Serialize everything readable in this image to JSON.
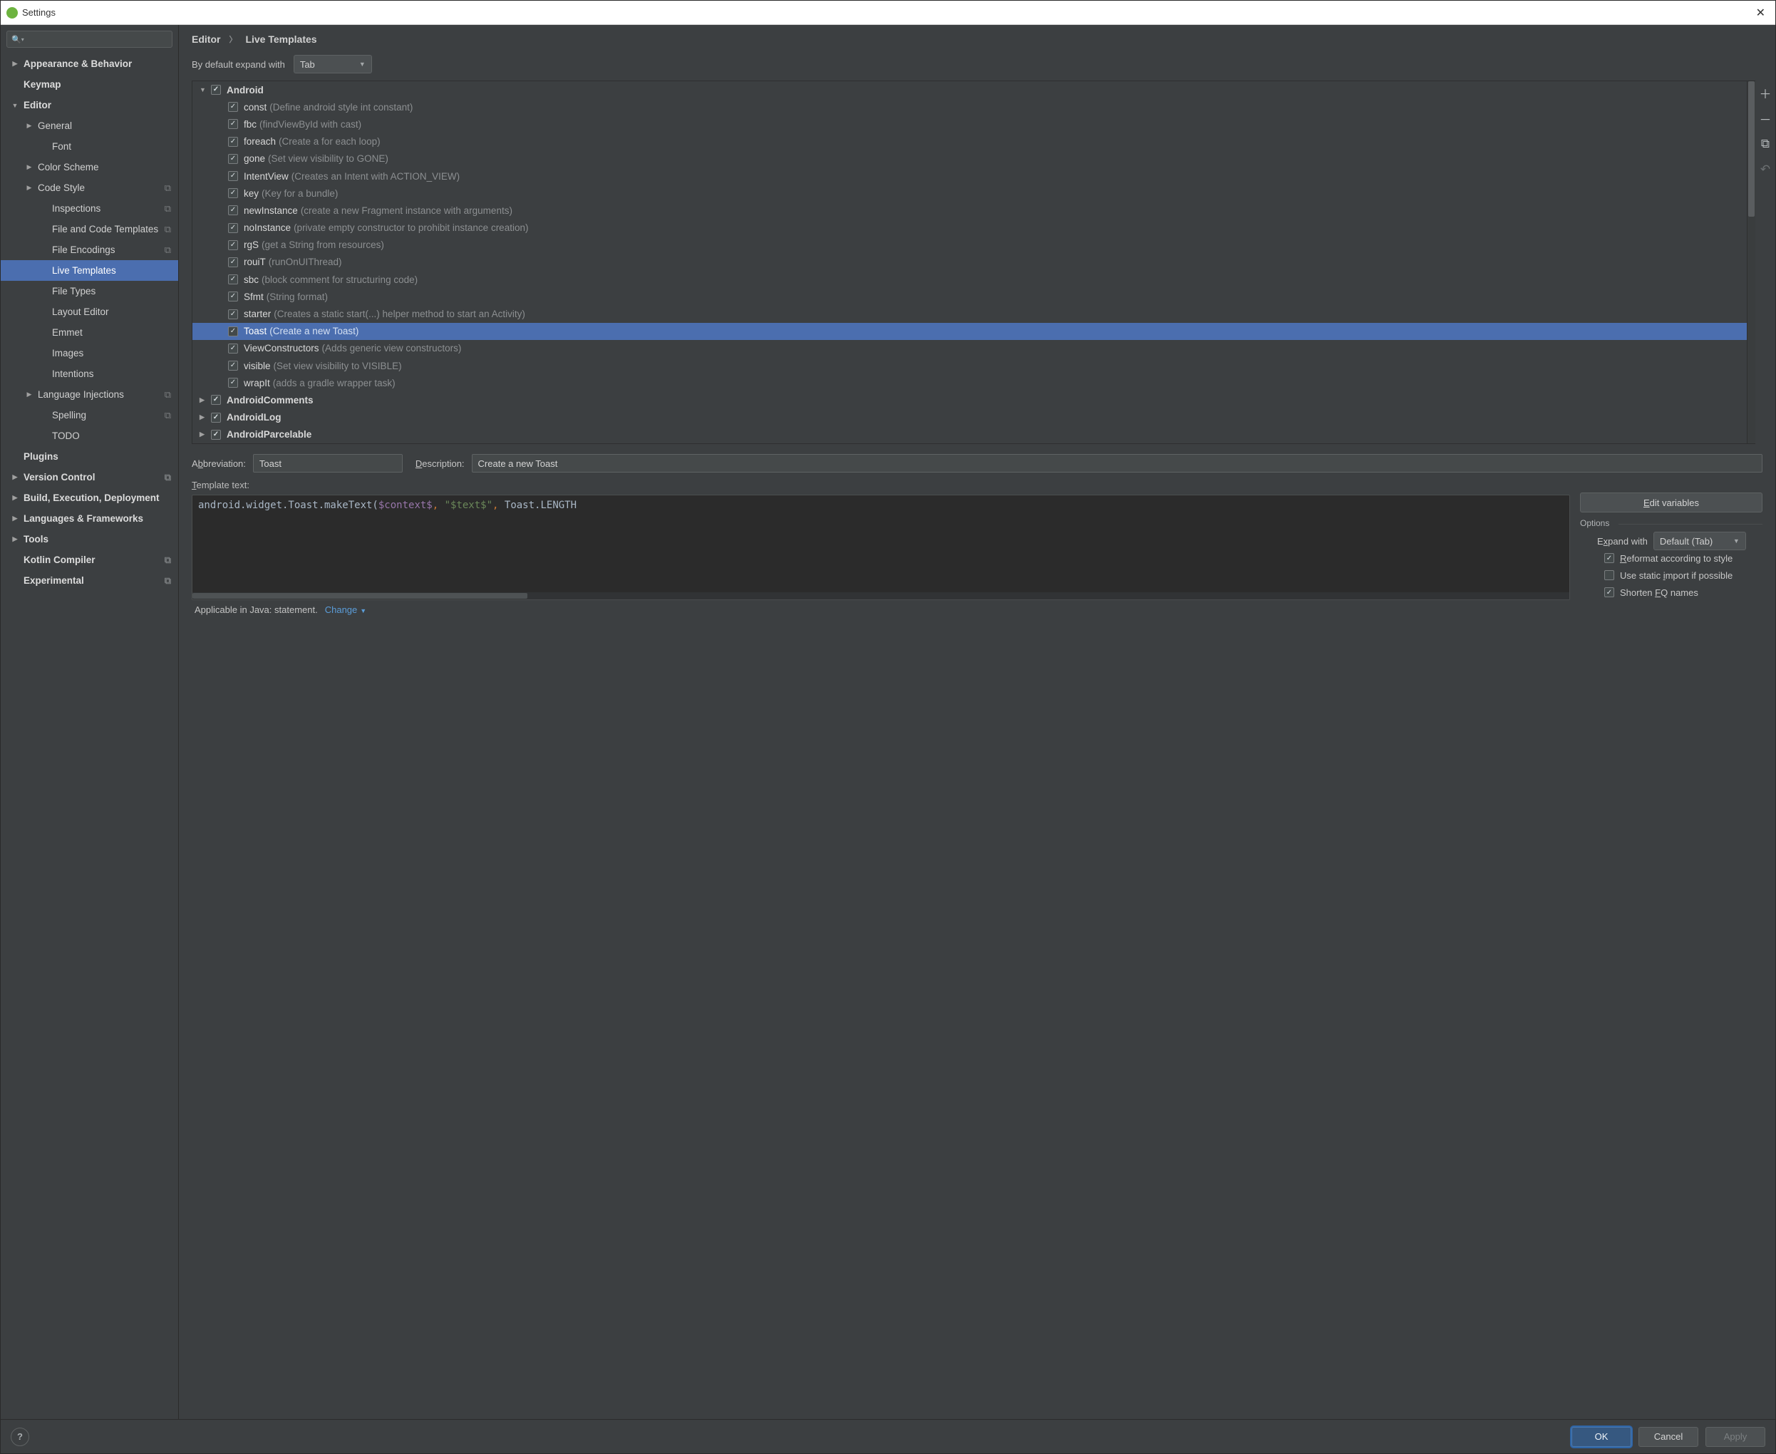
{
  "window": {
    "title": "Settings"
  },
  "breadcrumb": {
    "parent": "Editor",
    "current": "Live Templates"
  },
  "expand_default": {
    "label": "By default expand with",
    "value": "Tab"
  },
  "sidebar": {
    "search_placeholder": "",
    "items": [
      {
        "label": "Appearance & Behavior",
        "bold": true,
        "arrow": "right"
      },
      {
        "label": "Keymap",
        "bold": true
      },
      {
        "label": "Editor",
        "bold": true,
        "arrow": "down"
      },
      {
        "label": "General",
        "indent": 1,
        "arrow": "right"
      },
      {
        "label": "Font",
        "indent": 2
      },
      {
        "label": "Color Scheme",
        "indent": 1,
        "arrow": "right"
      },
      {
        "label": "Code Style",
        "indent": 1,
        "arrow": "right",
        "schema": true
      },
      {
        "label": "Inspections",
        "indent": 2,
        "schema": true
      },
      {
        "label": "File and Code Templates",
        "indent": 2,
        "schema": true
      },
      {
        "label": "File Encodings",
        "indent": 2,
        "schema": true
      },
      {
        "label": "Live Templates",
        "indent": 2,
        "selected": true
      },
      {
        "label": "File Types",
        "indent": 2
      },
      {
        "label": "Layout Editor",
        "indent": 2
      },
      {
        "label": "Emmet",
        "indent": 2
      },
      {
        "label": "Images",
        "indent": 2
      },
      {
        "label": "Intentions",
        "indent": 2
      },
      {
        "label": "Language Injections",
        "indent": 1,
        "arrow": "right",
        "schema": true
      },
      {
        "label": "Spelling",
        "indent": 2,
        "schema": true
      },
      {
        "label": "TODO",
        "indent": 2
      },
      {
        "label": "Plugins",
        "bold": true
      },
      {
        "label": "Version Control",
        "bold": true,
        "arrow": "right",
        "schema": true
      },
      {
        "label": "Build, Execution, Deployment",
        "bold": true,
        "arrow": "right"
      },
      {
        "label": "Languages & Frameworks",
        "bold": true,
        "arrow": "right"
      },
      {
        "label": "Tools",
        "bold": true,
        "arrow": "right"
      },
      {
        "label": "Kotlin Compiler",
        "bold": true,
        "schema": true
      },
      {
        "label": "Experimental",
        "bold": true,
        "schema": true
      }
    ]
  },
  "templates": {
    "groups": [
      {
        "name": "Android",
        "expanded": true,
        "checked": true,
        "items": [
          {
            "abbr": "const",
            "desc": "(Define android style int constant)",
            "checked": true
          },
          {
            "abbr": "fbc",
            "desc": "(findViewById with cast)",
            "checked": true
          },
          {
            "abbr": "foreach",
            "desc": "(Create a for each loop)",
            "checked": true
          },
          {
            "abbr": "gone",
            "desc": "(Set view visibility to GONE)",
            "checked": true
          },
          {
            "abbr": "IntentView",
            "desc": "(Creates an Intent with ACTION_VIEW)",
            "checked": true
          },
          {
            "abbr": "key",
            "desc": "(Key for a bundle)",
            "checked": true
          },
          {
            "abbr": "newInstance",
            "desc": "(create a new Fragment instance with arguments)",
            "checked": true
          },
          {
            "abbr": "noInstance",
            "desc": "(private empty constructor to prohibit instance creation)",
            "checked": true
          },
          {
            "abbr": "rgS",
            "desc": "(get a String from resources)",
            "checked": true
          },
          {
            "abbr": "rouiT",
            "desc": "(runOnUIThread)",
            "checked": true
          },
          {
            "abbr": "sbc",
            "desc": "(block comment for structuring code)",
            "checked": true
          },
          {
            "abbr": "Sfmt",
            "desc": "(String format)",
            "checked": true
          },
          {
            "abbr": "starter",
            "desc": "(Creates a static start(...) helper method to start an Activity)",
            "checked": true
          },
          {
            "abbr": "Toast",
            "desc": "(Create a new Toast)",
            "checked": true,
            "selected": true
          },
          {
            "abbr": "ViewConstructors",
            "desc": "(Adds generic view constructors)",
            "checked": true
          },
          {
            "abbr": "visible",
            "desc": "(Set view visibility to VISIBLE)",
            "checked": true
          },
          {
            "abbr": "wrapIt",
            "desc": "(adds a gradle wrapper task)",
            "checked": true
          }
        ]
      },
      {
        "name": "AndroidComments",
        "expanded": false,
        "checked": true
      },
      {
        "name": "AndroidLog",
        "expanded": false,
        "checked": true
      },
      {
        "name": "AndroidParcelable",
        "expanded": false,
        "checked": true
      }
    ]
  },
  "form": {
    "abbreviation_label": "Abbreviation:",
    "abbreviation_value": "Toast",
    "description_label": "Description:",
    "description_value": "Create a new Toast",
    "template_text_label": "Template text:",
    "edit_variables": "Edit variables",
    "template_code": {
      "pre": "android.widget.Toast.makeText(",
      "var1": "$context$",
      "comma1": ", ",
      "str": "\"$text$\"",
      "comma2": ", ",
      "tail": "Toast.LENGTH"
    },
    "options_label": "Options",
    "expand_with_label": "Expand with",
    "expand_with_value": "Default (Tab)",
    "opt_reformat": "Reformat according to style",
    "opt_static_import": "Use static import if possible",
    "opt_shorten_fq": "Shorten FQ names",
    "applicable_text": "Applicable in Java: statement.",
    "change_link": "Change"
  },
  "footer": {
    "ok": "OK",
    "cancel": "Cancel",
    "apply": "Apply"
  }
}
